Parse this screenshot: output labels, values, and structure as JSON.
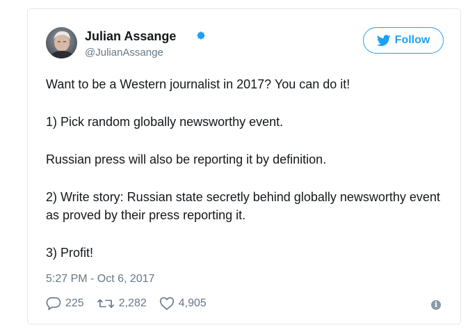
{
  "author": {
    "name": "Julian Assange",
    "handle": "@JulianAssange",
    "verified_icon": "verified-badge-icon"
  },
  "follow": {
    "label": "Follow",
    "icon": "twitter-bird-icon"
  },
  "tweet": {
    "lines": [
      "Want to be a Western journalist in 2017? You can do it!",
      "1) Pick random globally newsworthy event.",
      "Russian press will also be reporting it by definition.",
      "2) Write story: Russian state secretly behind globally newsworthy event as proved by their press reporting it.",
      "3) Profit!"
    ],
    "timestamp": "5:27 PM - Oct 6, 2017"
  },
  "actions": {
    "replies": "225",
    "retweets": "2,282",
    "likes": "4,905"
  },
  "colors": {
    "accent": "#1da1f2",
    "muted": "#657786",
    "text": "#14171a"
  }
}
